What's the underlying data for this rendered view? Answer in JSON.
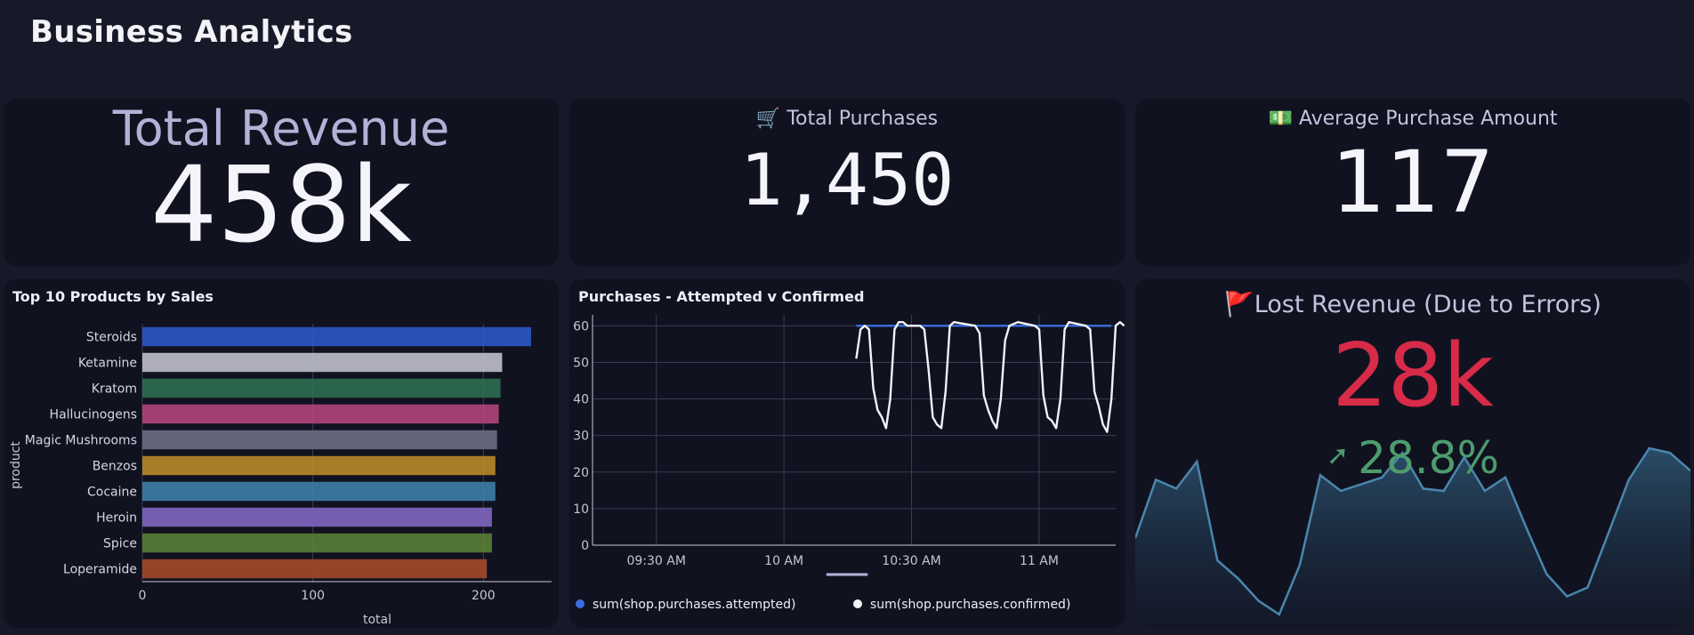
{
  "page": {
    "title": "Business Analytics"
  },
  "revenue": {
    "label": "Total Revenue",
    "value": "458k"
  },
  "purchases": {
    "icon": "shopping-cart-icon",
    "emoji": "🛒",
    "label": "Total Purchases",
    "value": "1,450"
  },
  "average": {
    "icon": "money-icon",
    "emoji": "💵",
    "label": "Average Purchase Amount",
    "value": "117"
  },
  "lost": {
    "icon": "red-flag-icon",
    "emoji": "🚩",
    "label": "Lost Revenue (Due to Errors)",
    "value": "28k",
    "delta": "28.8%",
    "delta_icon": "arrow-up-right-icon",
    "value_color": "#d72b48",
    "delta_color": "#4d9c6e",
    "sparkline": [
      40,
      66,
      62,
      74,
      30,
      22,
      12,
      6,
      28,
      68,
      61,
      64,
      67,
      78,
      62,
      61,
      76,
      61,
      67,
      45,
      24,
      14,
      18,
      42,
      66,
      80,
      78,
      70
    ]
  },
  "products_panel": {
    "title": "Top 10 Products by Sales"
  },
  "attempted_panel": {
    "title": "Purchases - Attempted v Confirmed"
  },
  "chart_data": [
    {
      "type": "bar",
      "orientation": "horizontal",
      "title": "Top 10 Products by Sales",
      "xlabel": "total",
      "ylabel": "product",
      "categories": [
        "Steroids",
        "Ketamine",
        "Kratom",
        "Hallucinogens",
        "Magic Mushrooms",
        "Benzos",
        "Cocaine",
        "Heroin",
        "Spice",
        "Loperamide"
      ],
      "values": [
        228,
        211,
        210,
        209,
        208,
        207,
        207,
        205,
        205,
        202
      ],
      "colors": [
        "#2e57c8",
        "#bfbfcc",
        "#2f6e52",
        "#b2457b",
        "#6d6d84",
        "#b98a2a",
        "#3f7ea7",
        "#8166c1",
        "#597f36",
        "#a24a2a"
      ],
      "xlim": [
        0,
        240
      ],
      "xticks": [
        0,
        100,
        200
      ],
      "grid": true
    },
    {
      "type": "line",
      "title": "Purchases - Attempted v Confirmed",
      "xlim": [
        "09:15 AM",
        "11:18 AM"
      ],
      "xticks": [
        "09:30 AM",
        "10 AM",
        "10:30 AM",
        "11 AM"
      ],
      "ylim": [
        0,
        63
      ],
      "yticks": [
        0,
        10,
        20,
        30,
        40,
        50,
        60
      ],
      "grid": true,
      "legend": "bottom",
      "series": [
        {
          "name": "sum(shop.purchases.attempted)",
          "color": "#3b6fe0",
          "points": [
            [
              "10:17 AM",
              60
            ],
            [
              "11:17 AM",
              60
            ]
          ]
        },
        {
          "name": "sum(shop.purchases.confirmed)",
          "color": "#f2f2f7",
          "points": [
            [
              "10:17 AM",
              51
            ],
            [
              "10:18 AM",
              59
            ],
            [
              "10:19 AM",
              60
            ],
            [
              "10:20 AM",
              59
            ],
            [
              "10:21 AM",
              43
            ],
            [
              "10:22 AM",
              37
            ],
            [
              "10:23 AM",
              35
            ],
            [
              "10:24 AM",
              32
            ],
            [
              "10:25 AM",
              40
            ],
            [
              "10:26 AM",
              59
            ],
            [
              "10:27 AM",
              61
            ],
            [
              "10:28 AM",
              61
            ],
            [
              "10:29 AM",
              60
            ],
            [
              "10:32 AM",
              60
            ],
            [
              "10:33 AM",
              59
            ],
            [
              "10:34 AM",
              48
            ],
            [
              "10:35 AM",
              35
            ],
            [
              "10:36 AM",
              33
            ],
            [
              "10:37 AM",
              32
            ],
            [
              "10:38 AM",
              42
            ],
            [
              "10:39 AM",
              60
            ],
            [
              "10:40 AM",
              61
            ],
            [
              "10:45 AM",
              60
            ],
            [
              "10:46 AM",
              58
            ],
            [
              "10:47 AM",
              41
            ],
            [
              "10:48 AM",
              37
            ],
            [
              "10:49 AM",
              34
            ],
            [
              "10:50 AM",
              32
            ],
            [
              "10:51 AM",
              40
            ],
            [
              "10:52 AM",
              56
            ],
            [
              "10:53 AM",
              60
            ],
            [
              "10:55 AM",
              61
            ],
            [
              "10:59 AM",
              60
            ],
            [
              "11:00 AM",
              59
            ],
            [
              "11:01 AM",
              41
            ],
            [
              "11:02 AM",
              35
            ],
            [
              "11:03 AM",
              34
            ],
            [
              "11:04 AM",
              32
            ],
            [
              "11:05 AM",
              40
            ],
            [
              "11:06 AM",
              59
            ],
            [
              "11:07 AM",
              61
            ],
            [
              "11:11 AM",
              60
            ],
            [
              "11:12 AM",
              59
            ],
            [
              "11:13 AM",
              42
            ],
            [
              "11:14 AM",
              38
            ],
            [
              "11:15 AM",
              33
            ],
            [
              "11:16 AM",
              31
            ],
            [
              "11:17 AM",
              40
            ],
            [
              "11:18 AM",
              60
            ],
            [
              "11:19 AM",
              61
            ],
            [
              "11:20 AM",
              60
            ]
          ]
        }
      ]
    }
  ]
}
